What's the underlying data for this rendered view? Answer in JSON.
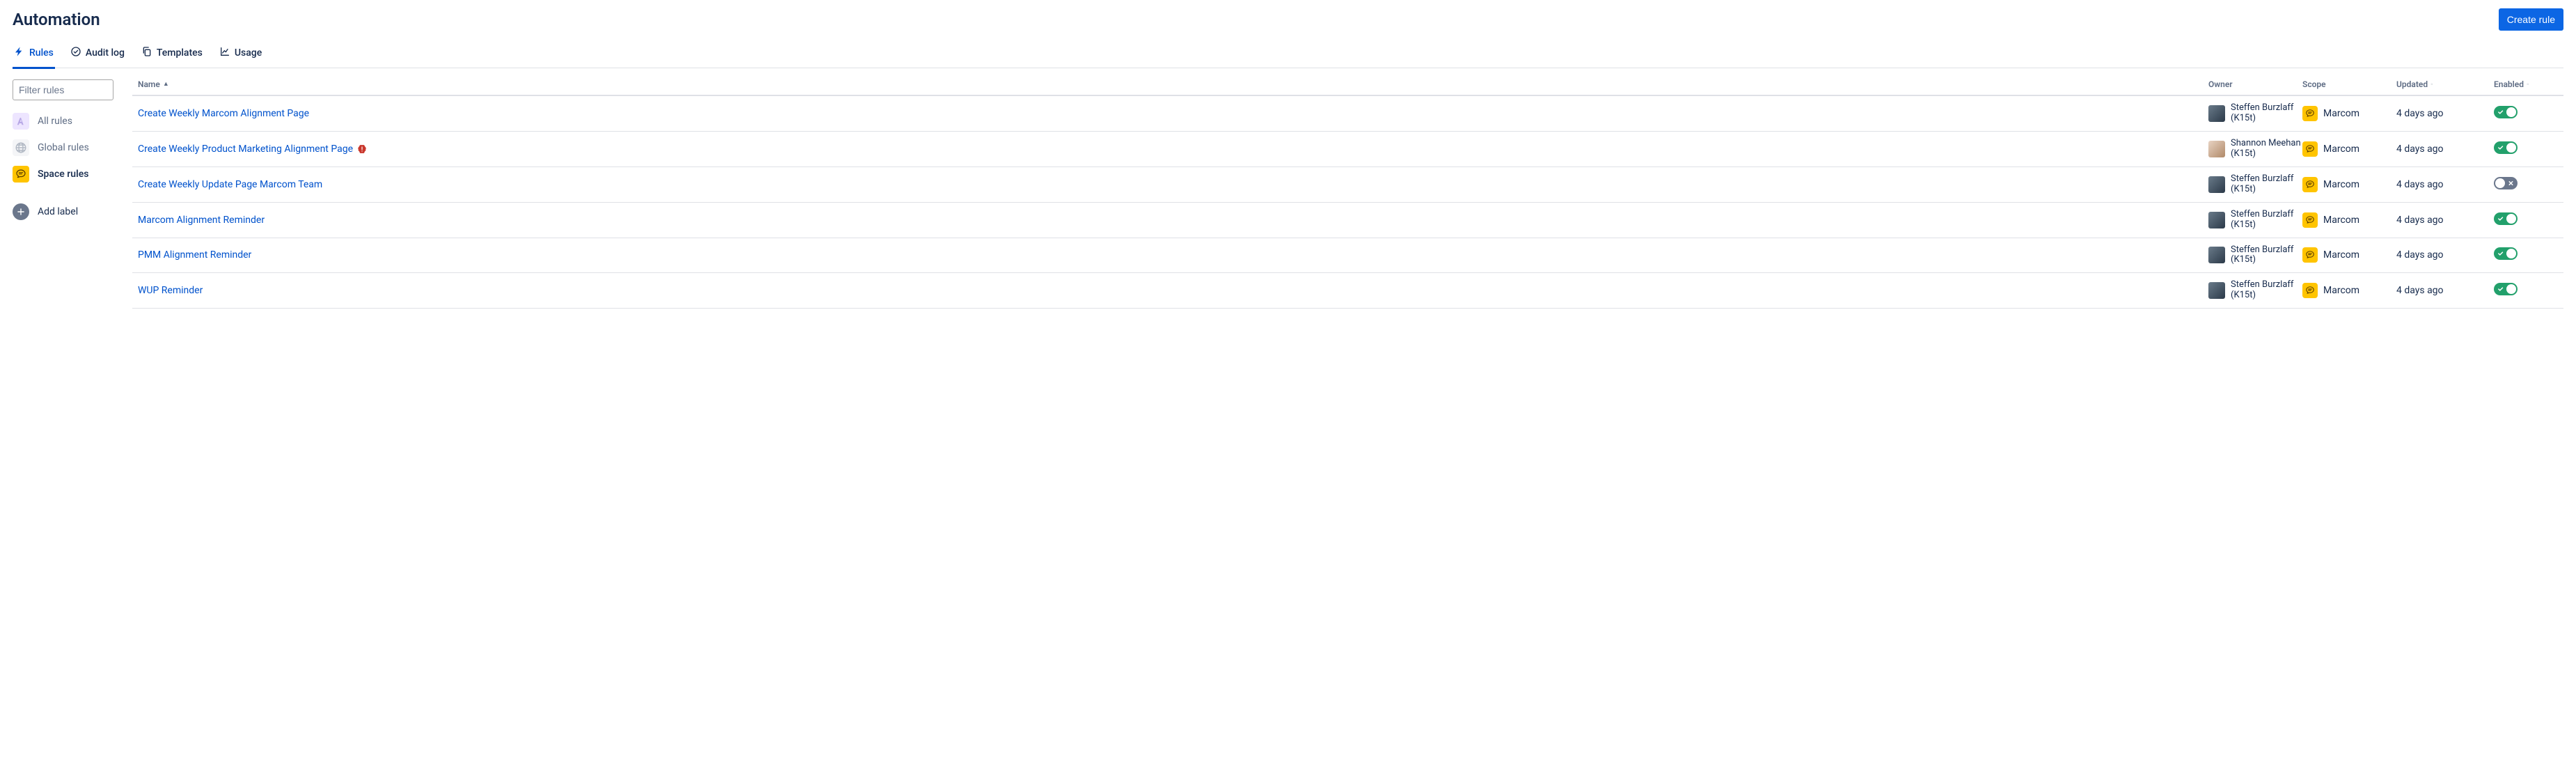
{
  "header": {
    "title": "Automation",
    "create_label": "Create rule"
  },
  "tabs": {
    "rules": "Rules",
    "audit": "Audit log",
    "templates": "Templates",
    "usage": "Usage",
    "active": "rules"
  },
  "sidebar": {
    "filter_placeholder": "Filter rules",
    "items": {
      "all": "All rules",
      "global": "Global rules",
      "space": "Space rules",
      "add": "Add label"
    },
    "selected": "space"
  },
  "table": {
    "columns": {
      "name": "Name",
      "owner": "Owner",
      "scope": "Scope",
      "updated": "Updated",
      "enabled": "Enabled"
    },
    "sort": {
      "column": "name",
      "direction": "asc"
    },
    "rows": [
      {
        "name": "Create Weekly Marcom Alignment Page",
        "warning": false,
        "owner": {
          "display": "Steffen Burzlaff",
          "sub": "(K15t)",
          "avatar_variant": "default"
        },
        "scope": "Marcom",
        "updated": "4 days ago",
        "enabled": true
      },
      {
        "name": "Create Weekly Product Marketing Alignment Page",
        "warning": true,
        "owner": {
          "display": "Shannon Meehan",
          "sub": "(K15t)",
          "avatar_variant": "alt"
        },
        "scope": "Marcom",
        "updated": "4 days ago",
        "enabled": true
      },
      {
        "name": "Create Weekly Update Page Marcom Team",
        "warning": false,
        "owner": {
          "display": "Steffen Burzlaff",
          "sub": "(K15t)",
          "avatar_variant": "default"
        },
        "scope": "Marcom",
        "updated": "4 days ago",
        "enabled": false
      },
      {
        "name": "Marcom Alignment Reminder",
        "warning": false,
        "owner": {
          "display": "Steffen Burzlaff",
          "sub": "(K15t)",
          "avatar_variant": "default"
        },
        "scope": "Marcom",
        "updated": "4 days ago",
        "enabled": true
      },
      {
        "name": "PMM Alignment Reminder",
        "warning": false,
        "owner": {
          "display": "Steffen Burzlaff",
          "sub": "(K15t)",
          "avatar_variant": "default"
        },
        "scope": "Marcom",
        "updated": "4 days ago",
        "enabled": true
      },
      {
        "name": "WUP Reminder",
        "warning": false,
        "owner": {
          "display": "Steffen Burzlaff",
          "sub": "(K15t)",
          "avatar_variant": "default"
        },
        "scope": "Marcom",
        "updated": "4 days ago",
        "enabled": true
      }
    ]
  },
  "icons": {
    "rules": "bolt-icon",
    "audit": "check-circle-icon",
    "templates": "copy-icon",
    "usage": "chart-line-icon",
    "scope": "space-icon",
    "warning": "alert-icon"
  }
}
